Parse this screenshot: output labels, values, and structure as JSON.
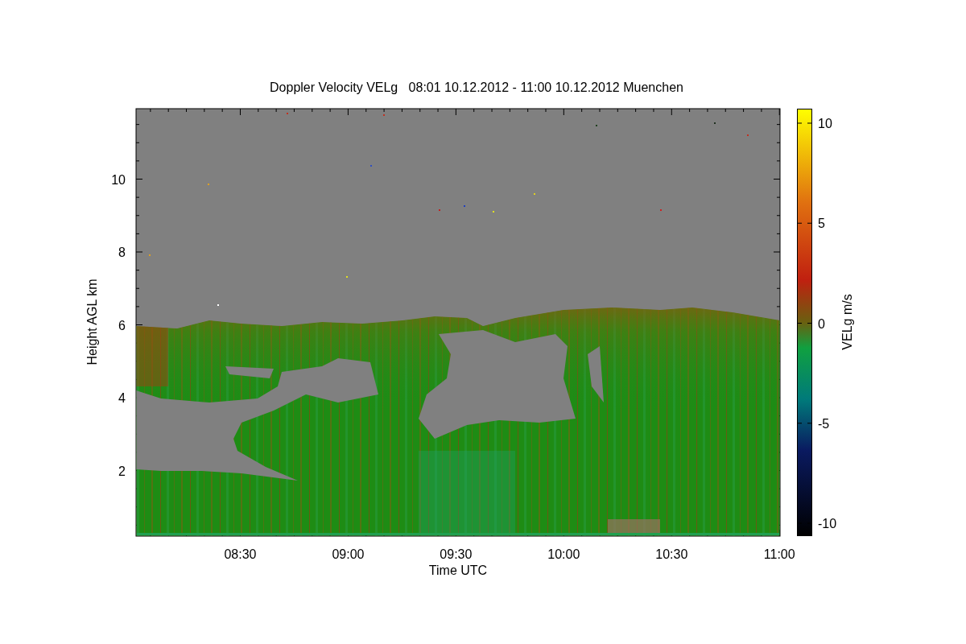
{
  "title": "Doppler Velocity VELg   08:01 10.12.2012 - 11:00 10.12.2012 Muenchen",
  "y_axis": {
    "label": "Height AGL km",
    "ticks": [
      "10",
      "8",
      "6",
      "4",
      "2"
    ]
  },
  "x_axis": {
    "label": "Time UTC",
    "ticks": [
      "08:30",
      "09:00",
      "09:30",
      "10:00",
      "10:30",
      "11:00"
    ]
  },
  "colorbar": {
    "label": "VELg m/s",
    "ticks": [
      "10",
      "5",
      "0",
      "-5",
      "-10"
    ]
  }
}
